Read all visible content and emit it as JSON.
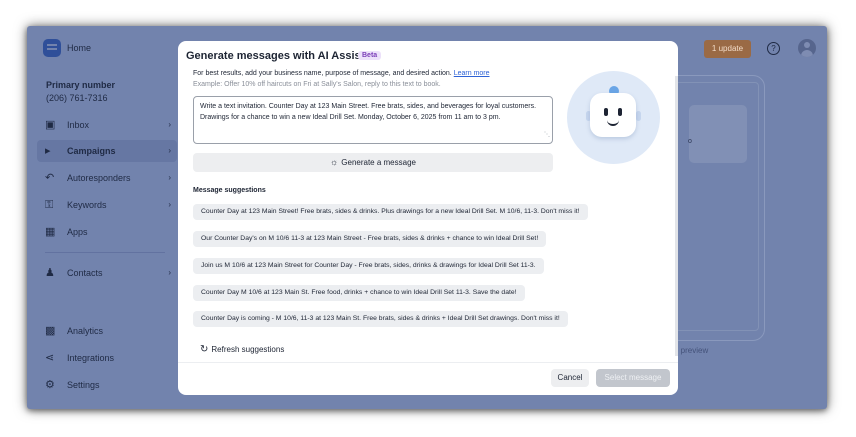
{
  "sidebar": {
    "home_label": "Home",
    "primary_number_label": "Primary number",
    "primary_number_value": "(206) 761-7316",
    "items": [
      {
        "label": "Inbox",
        "icon": "inbox-icon",
        "active": false
      },
      {
        "label": "Campaigns",
        "icon": "megaphone-icon",
        "active": true
      },
      {
        "label": "Autoresponders",
        "icon": "autoresponder-icon",
        "active": false
      },
      {
        "label": "Keywords",
        "icon": "key-icon",
        "active": false
      },
      {
        "label": "Apps",
        "icon": "apps-grid-icon",
        "active": false
      },
      {
        "label": "Contacts",
        "icon": "contacts-icon",
        "active": false
      },
      {
        "label": "Analytics",
        "icon": "analytics-icon",
        "active": false
      },
      {
        "label": "Integrations",
        "icon": "plug-icon",
        "active": false
      },
      {
        "label": "Settings",
        "icon": "gear-icon",
        "active": false
      }
    ]
  },
  "header": {
    "update_label": "1 update",
    "help_icon": "question-circle-icon",
    "avatar_icon": "user-avatar-icon"
  },
  "background": {
    "phone_bubble_text": "o",
    "preview_label": "e preview"
  },
  "modal": {
    "title": "Generate messages with AI Assist",
    "beta_label": "Beta",
    "intro_text": "For best results, add your business name, purpose of message, and desired action.",
    "learn_more_label": "Learn more",
    "example_text": "Example: Offer 10% off haircuts on Fri at Sally's Salon, reply to this text to book.",
    "prompt_value": "Write a text invitation. Counter Day at 123 Main Street. Free brats, sides, and beverages for loyal customers. Drawings for a chance to win a new Ideal Drill Set. Monday, October 6, 2025 from 11 am to 3 pm.",
    "generate_label": "Generate a message",
    "suggestions_heading": "Message suggestions",
    "suggestions": [
      "Counter Day at 123 Main Street! Free brats, sides & drinks. Plus drawings for a new Ideal Drill Set. M 10/6, 11-3. Don't miss it!",
      "Our Counter Day's on M 10/6 11-3 at 123 Main Street - Free brats, sides & drinks + chance to win Ideal Drill Set!",
      "Join us M 10/6 at 123 Main Street for Counter Day - Free brats, sides, drinks & drawings for Ideal Drill Set 11-3.",
      "Counter Day M 10/6 at 123 Main St. Free food, drinks + chance to win Ideal Drill Set 11-3. Save the date!",
      "Counter Day is coming - M 10/6, 11-3 at 123 Main St. Free brats, sides & drinks + Ideal Drill Set drawings. Don't miss it!"
    ],
    "refresh_label": "Refresh suggestions",
    "cancel_label": "Cancel",
    "select_label": "Select message"
  },
  "colors": {
    "overlay": "#7283ad",
    "accent_link": "#2d62d6",
    "beta_text": "#7b3fb8",
    "update_badge": "#9a6a45"
  }
}
